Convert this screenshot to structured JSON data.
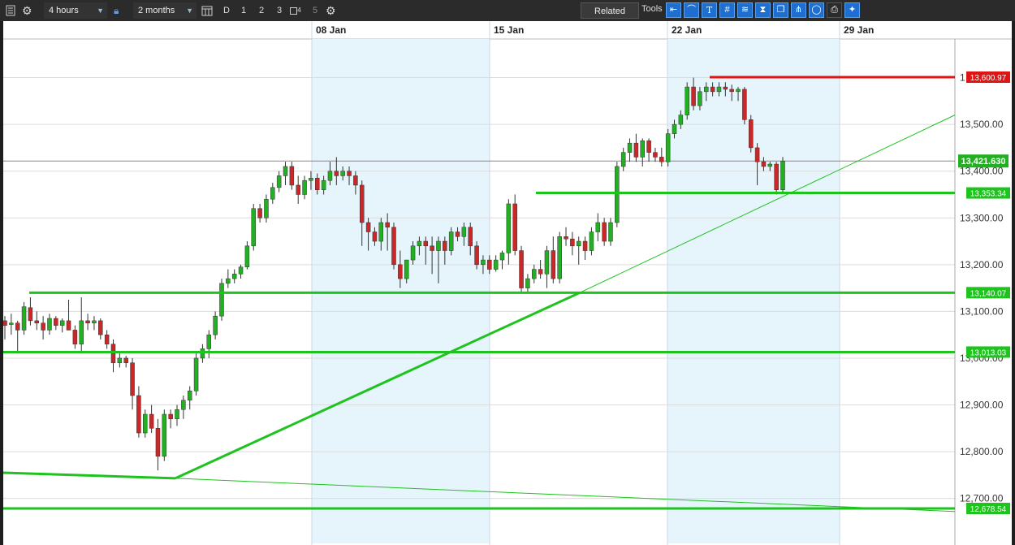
{
  "toolbar": {
    "timeframe": "4 hours",
    "range": "2 months",
    "period_buttons": [
      "D",
      "1",
      "2",
      "3",
      "4",
      "5"
    ],
    "related_label": "Related",
    "tools_label": "Tools"
  },
  "colors": {
    "up": "#22b022",
    "down": "#c82828",
    "line": "#1ec31e",
    "resistance": "#dd1515",
    "shade": "#e6f4fc",
    "grid": "#dcdcdc"
  },
  "icons": [
    "list-icon",
    "gear-icon",
    "lock-icon",
    "calendar-icon",
    "gear-icon",
    "arrow-tool-icon",
    "curve-tool-icon",
    "text-tool-icon",
    "grid-tool-icon",
    "fibonacci-tool-icon",
    "candle-tool-icon",
    "window-tool-icon",
    "pitchfork-tool-icon",
    "shape-tool-icon",
    "print-icon",
    "settings-tool-icon"
  ],
  "chart_data": {
    "type": "candlestick",
    "x_ticks": [
      "08 Jan",
      "15 Jan",
      "22 Jan",
      "29 Jan"
    ],
    "y_ticks": [
      "12,700.00",
      "12,800.00",
      "12,900.00",
      "13,000.00",
      "13,100.00",
      "13,200.00",
      "13,300.00",
      "13,400.00",
      "13,500.00",
      "1"
    ],
    "ylim": [
      12645,
      13685
    ],
    "current_price": "13,421.630",
    "levels": [
      {
        "value": 13600.97,
        "label": "13,600.97",
        "role": "resistance"
      },
      {
        "value": 13353.34,
        "label": "13,353.34",
        "role": "support"
      },
      {
        "value": 13140.07,
        "label": "13,140.07",
        "role": "support"
      },
      {
        "value": 13013.03,
        "label": "13,013.03",
        "role": "support"
      },
      {
        "value": 12678.54,
        "label": "12,678.54",
        "role": "support"
      }
    ],
    "candles": [
      [
        13080,
        13090,
        13040,
        13070
      ],
      [
        13072,
        13095,
        13050,
        13075
      ],
      [
        13075,
        13080,
        13010,
        13060
      ],
      [
        13060,
        13120,
        13050,
        13110
      ],
      [
        13108,
        13130,
        13070,
        13080
      ],
      [
        13080,
        13100,
        13060,
        13075
      ],
      [
        13075,
        13090,
        13040,
        13060
      ],
      [
        13060,
        13095,
        13050,
        13085
      ],
      [
        13085,
        13090,
        13060,
        13070
      ],
      [
        13070,
        13085,
        13055,
        13080
      ],
      [
        13080,
        13125,
        13060,
        13060
      ],
      [
        13060,
        13070,
        13020,
        13030
      ],
      [
        13030,
        13130,
        13010,
        13080
      ],
      [
        13080,
        13095,
        13060,
        13075
      ],
      [
        13075,
        13090,
        13060,
        13080
      ],
      [
        13080,
        13085,
        13040,
        13050
      ],
      [
        13050,
        13060,
        13020,
        13030
      ],
      [
        13030,
        13040,
        12970,
        12990
      ],
      [
        12990,
        13010,
        12980,
        13000
      ],
      [
        13000,
        13005,
        12980,
        12990
      ],
      [
        12990,
        13000,
        12890,
        12920
      ],
      [
        12920,
        12940,
        12830,
        12840
      ],
      [
        12840,
        12890,
        12830,
        12880
      ],
      [
        12880,
        12900,
        12840,
        12850
      ],
      [
        12850,
        12870,
        12760,
        12790
      ],
      [
        12790,
        12890,
        12780,
        12880
      ],
      [
        12880,
        12890,
        12850,
        12870
      ],
      [
        12870,
        12900,
        12855,
        12890
      ],
      [
        12890,
        12920,
        12870,
        12910
      ],
      [
        12910,
        12940,
        12890,
        12930
      ],
      [
        12930,
        13010,
        12920,
        13000
      ],
      [
        13000,
        13030,
        12990,
        13020
      ],
      [
        13020,
        13060,
        13000,
        13050
      ],
      [
        13050,
        13100,
        13040,
        13090
      ],
      [
        13090,
        13170,
        13080,
        13160
      ],
      [
        13160,
        13190,
        13150,
        13170
      ],
      [
        13170,
        13190,
        13160,
        13180
      ],
      [
        13180,
        13200,
        13170,
        13195
      ],
      [
        13195,
        13250,
        13190,
        13240
      ],
      [
        13240,
        13330,
        13230,
        13320
      ],
      [
        13320,
        13330,
        13290,
        13300
      ],
      [
        13300,
        13350,
        13290,
        13340
      ],
      [
        13340,
        13375,
        13330,
        13365
      ],
      [
        13365,
        13400,
        13355,
        13390
      ],
      [
        13390,
        13420,
        13370,
        13410
      ],
      [
        13410,
        13420,
        13360,
        13370
      ],
      [
        13370,
        13390,
        13330,
        13350
      ],
      [
        13350,
        13390,
        13340,
        13380
      ],
      [
        13380,
        13400,
        13360,
        13385
      ],
      [
        13385,
        13395,
        13350,
        13360
      ],
      [
        13360,
        13390,
        13350,
        13380
      ],
      [
        13380,
        13420,
        13370,
        13400
      ],
      [
        13400,
        13430,
        13370,
        13390
      ],
      [
        13390,
        13410,
        13380,
        13400
      ],
      [
        13400,
        13410,
        13370,
        13390
      ],
      [
        13390,
        13400,
        13350,
        13370
      ],
      [
        13370,
        13380,
        13240,
        13290
      ],
      [
        13290,
        13300,
        13230,
        13270
      ],
      [
        13270,
        13280,
        13240,
        13250
      ],
      [
        13250,
        13300,
        13230,
        13290
      ],
      [
        13290,
        13310,
        13230,
        13280
      ],
      [
        13280,
        13290,
        13190,
        13200
      ],
      [
        13200,
        13230,
        13150,
        13170
      ],
      [
        13170,
        13210,
        13160,
        13210
      ],
      [
        13210,
        13250,
        13200,
        13240
      ],
      [
        13240,
        13260,
        13220,
        13250
      ],
      [
        13250,
        13260,
        13200,
        13240
      ],
      [
        13240,
        13260,
        13180,
        13230
      ],
      [
        13230,
        13260,
        13160,
        13250
      ],
      [
        13250,
        13260,
        13200,
        13230
      ],
      [
        13230,
        13280,
        13220,
        13270
      ],
      [
        13270,
        13280,
        13250,
        13260
      ],
      [
        13260,
        13290,
        13240,
        13280
      ],
      [
        13280,
        13290,
        13220,
        13240
      ],
      [
        13240,
        13250,
        13190,
        13200
      ],
      [
        13200,
        13220,
        13180,
        13210
      ],
      [
        13210,
        13220,
        13180,
        13190
      ],
      [
        13190,
        13220,
        13185,
        13210
      ],
      [
        13210,
        13230,
        13190,
        13225
      ],
      [
        13225,
        13340,
        13200,
        13330
      ],
      [
        13330,
        13350,
        13220,
        13230
      ],
      [
        13230,
        13240,
        13140,
        13150
      ],
      [
        13150,
        13180,
        13140,
        13170
      ],
      [
        13170,
        13200,
        13160,
        13190
      ],
      [
        13190,
        13210,
        13170,
        13180
      ],
      [
        13180,
        13240,
        13150,
        13230
      ],
      [
        13230,
        13260,
        13160,
        13170
      ],
      [
        13170,
        13270,
        13160,
        13260
      ],
      [
        13260,
        13280,
        13240,
        13255
      ],
      [
        13255,
        13270,
        13220,
        13240
      ],
      [
        13240,
        13260,
        13200,
        13250
      ],
      [
        13250,
        13260,
        13210,
        13230
      ],
      [
        13230,
        13280,
        13220,
        13270
      ],
      [
        13270,
        13310,
        13250,
        13290
      ],
      [
        13290,
        13300,
        13240,
        13250
      ],
      [
        13250,
        13300,
        13240,
        13290
      ],
      [
        13290,
        13420,
        13280,
        13410
      ],
      [
        13410,
        13450,
        13400,
        13440
      ],
      [
        13440,
        13470,
        13420,
        13460
      ],
      [
        13460,
        13480,
        13420,
        13430
      ],
      [
        13430,
        13470,
        13410,
        13465
      ],
      [
        13465,
        13470,
        13420,
        13440
      ],
      [
        13440,
        13450,
        13420,
        13430
      ],
      [
        13430,
        13450,
        13410,
        13420
      ],
      [
        13420,
        13490,
        13410,
        13480
      ],
      [
        13480,
        13510,
        13470,
        13500
      ],
      [
        13500,
        13530,
        13490,
        13520
      ],
      [
        13520,
        13590,
        13510,
        13580
      ],
      [
        13580,
        13600,
        13530,
        13540
      ],
      [
        13540,
        13580,
        13530,
        13570
      ],
      [
        13570,
        13590,
        13550,
        13580
      ],
      [
        13580,
        13590,
        13560,
        13570
      ],
      [
        13570,
        13590,
        13560,
        13580
      ],
      [
        13580,
        13590,
        13560,
        13575
      ],
      [
        13575,
        13585,
        13550,
        13570
      ],
      [
        13570,
        13580,
        13550,
        13575
      ],
      [
        13575,
        13580,
        13500,
        13510
      ],
      [
        13510,
        13520,
        13440,
        13450
      ],
      [
        13450,
        13460,
        13370,
        13420
      ],
      [
        13420,
        13430,
        13400,
        13410
      ],
      [
        13410,
        13420,
        13400,
        13415
      ],
      [
        13415,
        13420,
        13350,
        13360
      ],
      [
        13360,
        13430,
        13355,
        13421.63
      ]
    ]
  }
}
